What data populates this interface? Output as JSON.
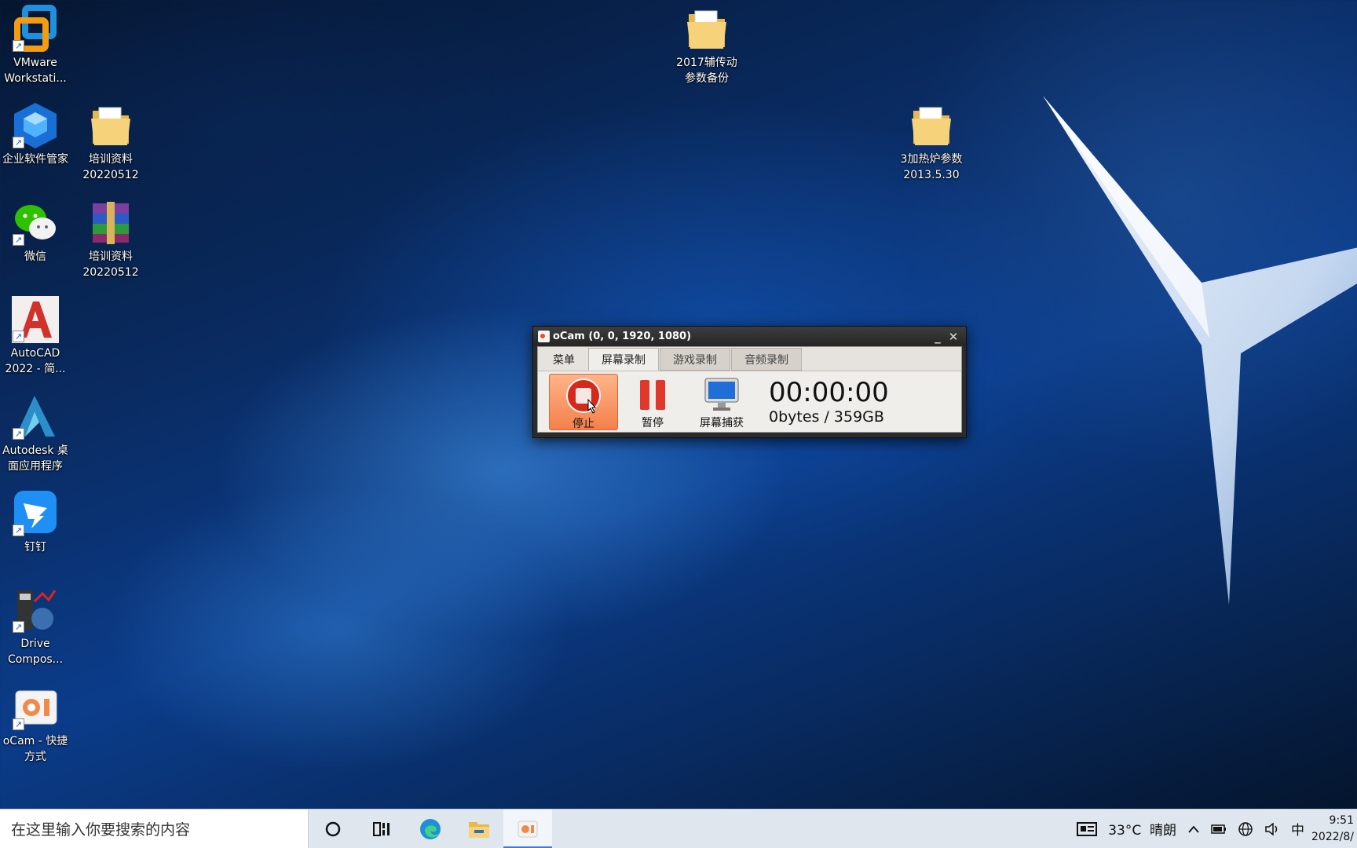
{
  "desktop": {
    "icons": [
      {
        "label": "VMware Workstati...",
        "icon": "vmware-icon",
        "shortcut": true
      },
      {
        "label": "企业软件管家",
        "icon": "cube-software-manager-icon",
        "shortcut": true
      },
      {
        "label": "培训资料\n20220512",
        "icon": "folder-icon",
        "shortcut": false
      },
      {
        "label": "微信",
        "icon": "wechat-icon",
        "shortcut": true
      },
      {
        "label": "培训资料\n20220512",
        "icon": "winrar-archive-icon",
        "shortcut": false
      },
      {
        "label": "AutoCAD 2022 - 简...",
        "icon": "autocad-icon",
        "shortcut": true
      },
      {
        "label": "Autodesk 桌面应用程序",
        "icon": "autodesk-icon",
        "shortcut": true
      },
      {
        "label": "钉钉",
        "icon": "dingtalk-icon",
        "shortcut": true
      },
      {
        "label": "Drive Compos...",
        "icon": "drive-composer-icon",
        "shortcut": true
      },
      {
        "label": "oCam - 快捷方式",
        "icon": "ocam-icon",
        "shortcut": true
      },
      {
        "label": "2017辅传动\n参数备份",
        "icon": "folder-icon",
        "shortcut": false
      },
      {
        "label": "3加热炉参数\n2013.5.30",
        "icon": "folder-icon",
        "shortcut": false
      }
    ]
  },
  "ocam": {
    "title": "oCam (0, 0, 1920, 1080)",
    "minimize": "_",
    "close": "✕",
    "tabs": [
      "菜单",
      "屏幕录制",
      "游戏录制",
      "音频录制"
    ],
    "active_tab": "屏幕录制",
    "buttons": {
      "stop": "停止",
      "pause": "暂停",
      "capture": "屏幕捕获"
    },
    "time": "00:00:00",
    "size": "0bytes / 359GB",
    "colors": {
      "stop_bg": "#f4804a",
      "stop_icon": "#d42a1c"
    }
  },
  "taskbar": {
    "search_placeholder": "在这里输入你要搜索的内容",
    "weather": "33°C  晴朗",
    "ime": "中",
    "time": "9:51",
    "date": "2022/8/"
  }
}
